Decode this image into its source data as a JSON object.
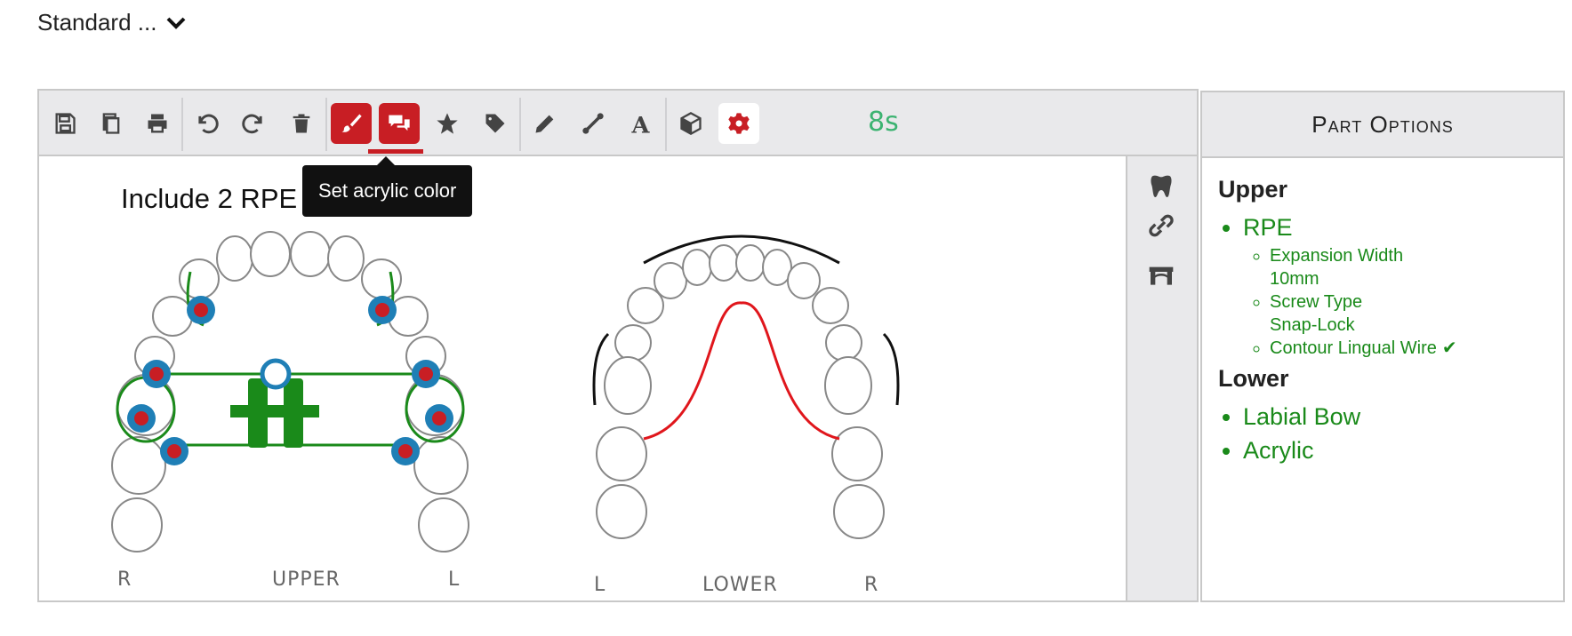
{
  "header": {
    "dropdown_label": "Standard ..."
  },
  "toolbar": {
    "buttons": [
      "save-icon",
      "copy-icon",
      "print-icon",
      "undo-icon",
      "redo-icon",
      "trash-icon",
      "paint-brush-icon",
      "comments-icon",
      "star-icon",
      "tag-icon",
      "pencil-icon",
      "bezier-icon",
      "text-icon",
      "cube-icon",
      "gear-icon"
    ],
    "timer": "8s",
    "tooltip": "Set acrylic color",
    "active_color": "#c81e24"
  },
  "canvas": {
    "notice": "Include 2 RPE",
    "upper": {
      "label": "UPPER",
      "left_side": "R",
      "right_side": "L"
    },
    "lower": {
      "label": "LOWER",
      "left_side": "L",
      "right_side": "R"
    }
  },
  "side_tools": [
    "tooth-icon",
    "link-icon",
    "bridge-icon"
  ],
  "panel": {
    "title": "Part Options",
    "upper_title": "Upper",
    "upper_part": "RPE",
    "options": [
      {
        "name": "Expansion Width",
        "value": "10mm"
      },
      {
        "name": "Screw Type",
        "value": "Snap-Lock"
      },
      {
        "name": "Contour Lingual Wire",
        "value": "✔"
      }
    ],
    "lower_title": "Lower",
    "lower_parts": [
      "Labial Bow",
      "Acrylic"
    ]
  },
  "colors": {
    "green": "#1a8a1a",
    "red": "#c81e24",
    "timer_green": "#3cb371",
    "band_blue": "#1f7fb6"
  }
}
